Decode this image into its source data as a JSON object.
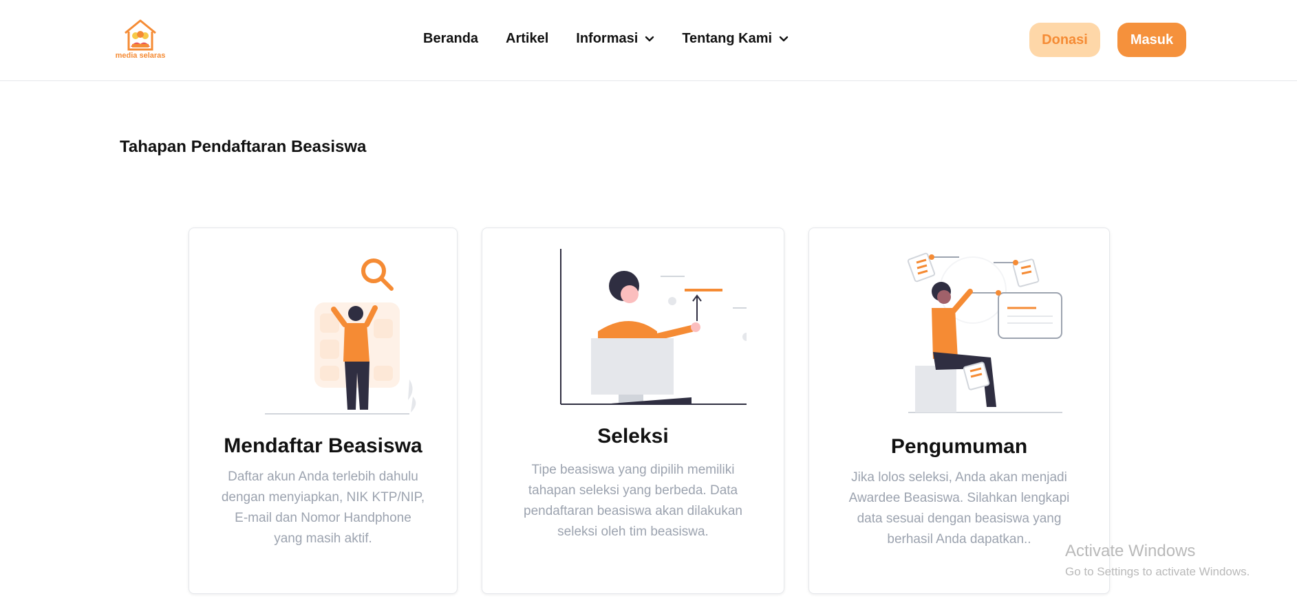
{
  "brand": {
    "logo_text": "media selaras",
    "accent": "#f5913c",
    "accent_light": "#fed7a8"
  },
  "nav": {
    "items": [
      {
        "label": "Beranda",
        "dropdown": false
      },
      {
        "label": "Artikel",
        "dropdown": false
      },
      {
        "label": "Informasi",
        "dropdown": true
      },
      {
        "label": "Tentang Kami",
        "dropdown": true
      }
    ],
    "donasi_label": "Donasi",
    "masuk_label": "Masuk"
  },
  "section": {
    "title": "Tahapan Pendaftaran Beasiswa"
  },
  "cards": [
    {
      "title": "Mendaftar Beasiswa",
      "description": "Daftar akun Anda terlebih dahulu dengan menyiapkan, NIK KTP/NIP, E-mail dan Nomor Handphone yang masih aktif.",
      "illustration": "search-register-illustration"
    },
    {
      "title": "Seleksi",
      "description": "Tipe beasiswa yang dipilih memiliki tahapan seleksi yang berbeda. Data pendaftaran beasiswa akan dilakukan seleksi oleh tim beasiswa.",
      "illustration": "computer-selection-illustration"
    },
    {
      "title": "Pengumuman",
      "description": "Jika lolos seleksi, Anda akan menjadi Awardee Beasiswa. Silahkan lengkapi data sesuai dengan beasiswa yang berhasil Anda dapatkan..",
      "illustration": "announcement-illustration"
    }
  ],
  "watermark": {
    "title": "Activate Windows",
    "subtitle": "Go to Settings to activate Windows."
  }
}
